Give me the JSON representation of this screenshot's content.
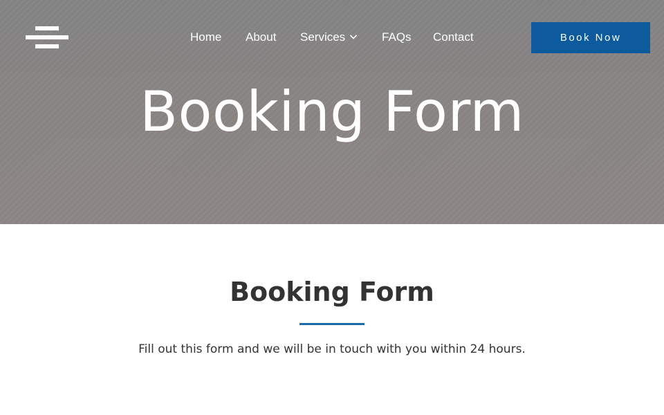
{
  "header": {
    "logo_icon": "menu-lines-logo-icon",
    "nav": {
      "home": "Home",
      "about": "About",
      "services": "Services",
      "faqs": "FAQs",
      "contact": "Contact"
    },
    "book_button_label": "Book Now"
  },
  "hero": {
    "title": "Booking Form"
  },
  "content": {
    "title": "Booking Form",
    "description": "Fill out this form and we will be in touch with you within 24 hours."
  },
  "colors": {
    "accent": "#0d5a9e",
    "divider": "#1c6ba8",
    "hero_overlay": "#8a8684",
    "text": "#333333"
  }
}
